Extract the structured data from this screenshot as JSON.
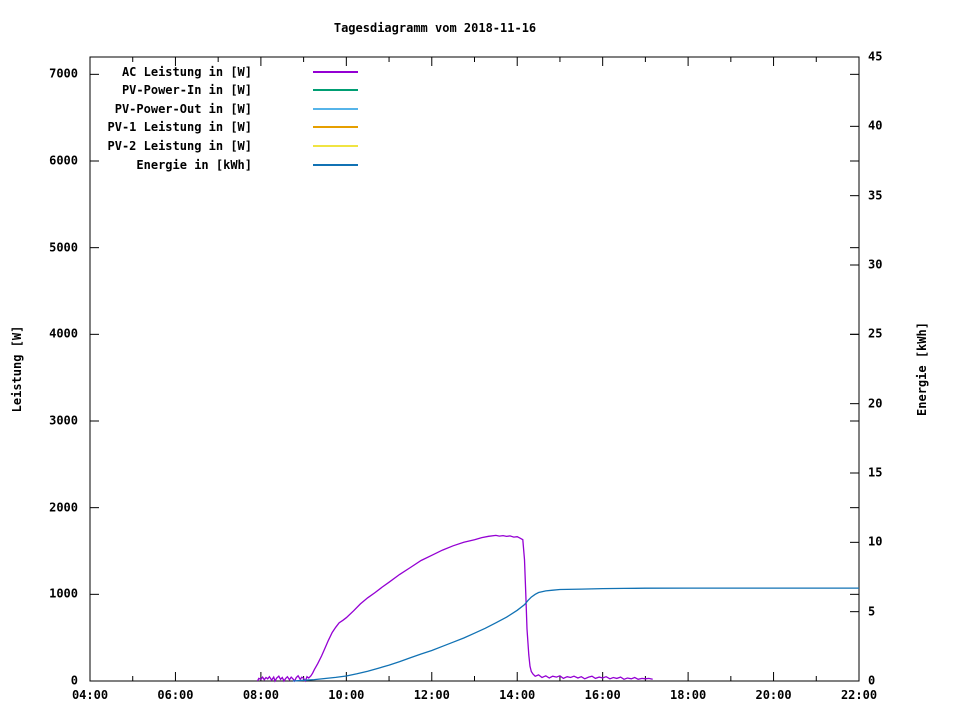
{
  "title": "Tagesdiagramm vom 2018-11-16",
  "chart_data": {
    "type": "line",
    "title": "Tagesdiagramm vom 2018-11-16",
    "grid": false,
    "legend_position": "top-left-inside",
    "x_axis": {
      "kind": "time",
      "range_hours": [
        4,
        22
      ],
      "major_step_hours": 2,
      "minor_step_hours": 1,
      "tick_labels": [
        "04:00",
        "06:00",
        "08:00",
        "10:00",
        "12:00",
        "14:00",
        "16:00",
        "18:00",
        "20:00",
        "22:00"
      ]
    },
    "y_axis": {
      "label": "Leistung [W]",
      "range": [
        0,
        7200
      ],
      "tick_values": [
        0,
        1000,
        2000,
        3000,
        4000,
        5000,
        6000,
        7000
      ],
      "tick_labels": [
        "0",
        "1000",
        "2000",
        "3000",
        "4000",
        "5000",
        "6000",
        "7000"
      ],
      "mirrored_on_right": true
    },
    "y2_axis": {
      "label": "Energie [kWh]",
      "range": [
        0,
        45
      ],
      "tick_values": [
        0,
        5,
        10,
        15,
        20,
        25,
        30,
        35,
        40,
        45
      ],
      "tick_labels": [
        "0",
        "5",
        "10",
        "15",
        "20",
        "25",
        "30",
        "35",
        "40",
        "45"
      ]
    },
    "series": [
      {
        "name": "AC Leistung in [W]",
        "color": "#9400D3",
        "axis": "y1",
        "points": [
          [
            7.92,
            0
          ],
          [
            7.95,
            30
          ],
          [
            8.0,
            20
          ],
          [
            8.04,
            45
          ],
          [
            8.08,
            15
          ],
          [
            8.12,
            40
          ],
          [
            8.16,
            25
          ],
          [
            8.2,
            50
          ],
          [
            8.25,
            10
          ],
          [
            8.3,
            45
          ],
          [
            8.33,
            0
          ],
          [
            8.37,
            35
          ],
          [
            8.42,
            55
          ],
          [
            8.46,
            20
          ],
          [
            8.5,
            40
          ],
          [
            8.54,
            0
          ],
          [
            8.58,
            30
          ],
          [
            8.62,
            50
          ],
          [
            8.67,
            15
          ],
          [
            8.71,
            45
          ],
          [
            8.75,
            25
          ],
          [
            8.79,
            0
          ],
          [
            8.83,
            40
          ],
          [
            8.87,
            60
          ],
          [
            8.92,
            20
          ],
          [
            8.96,
            45
          ],
          [
            9.0,
            30
          ],
          [
            9.04,
            0
          ],
          [
            9.08,
            50
          ],
          [
            9.12,
            35
          ],
          [
            9.17,
            60
          ],
          [
            9.21,
            90
          ],
          [
            9.25,
            130
          ],
          [
            9.33,
            200
          ],
          [
            9.42,
            290
          ],
          [
            9.5,
            380
          ],
          [
            9.58,
            470
          ],
          [
            9.67,
            560
          ],
          [
            9.75,
            620
          ],
          [
            9.83,
            670
          ],
          [
            9.92,
            700
          ],
          [
            10.0,
            730
          ],
          [
            10.17,
            810
          ],
          [
            10.33,
            890
          ],
          [
            10.5,
            960
          ],
          [
            10.67,
            1020
          ],
          [
            10.83,
            1080
          ],
          [
            11.0,
            1140
          ],
          [
            11.25,
            1230
          ],
          [
            11.5,
            1310
          ],
          [
            11.75,
            1390
          ],
          [
            12.0,
            1450
          ],
          [
            12.25,
            1510
          ],
          [
            12.5,
            1560
          ],
          [
            12.75,
            1600
          ],
          [
            13.0,
            1630
          ],
          [
            13.17,
            1655
          ],
          [
            13.33,
            1670
          ],
          [
            13.5,
            1680
          ],
          [
            13.58,
            1672
          ],
          [
            13.67,
            1678
          ],
          [
            13.75,
            1668
          ],
          [
            13.83,
            1674
          ],
          [
            13.92,
            1660
          ],
          [
            14.0,
            1665
          ],
          [
            14.08,
            1645
          ],
          [
            14.13,
            1630
          ],
          [
            14.17,
            1400
          ],
          [
            14.2,
            1000
          ],
          [
            14.23,
            600
          ],
          [
            14.27,
            300
          ],
          [
            14.3,
            170
          ],
          [
            14.33,
            110
          ],
          [
            14.37,
            80
          ],
          [
            14.42,
            55
          ],
          [
            14.5,
            70
          ],
          [
            14.58,
            40
          ],
          [
            14.67,
            60
          ],
          [
            14.75,
            35
          ],
          [
            14.83,
            55
          ],
          [
            14.92,
            45
          ],
          [
            15.0,
            60
          ],
          [
            15.08,
            30
          ],
          [
            15.17,
            50
          ],
          [
            15.25,
            40
          ],
          [
            15.33,
            55
          ],
          [
            15.42,
            35
          ],
          [
            15.5,
            50
          ],
          [
            15.58,
            25
          ],
          [
            15.67,
            45
          ],
          [
            15.75,
            55
          ],
          [
            15.83,
            30
          ],
          [
            15.92,
            45
          ],
          [
            16.0,
            35
          ],
          [
            16.08,
            50
          ],
          [
            16.17,
            25
          ],
          [
            16.25,
            40
          ],
          [
            16.33,
            30
          ],
          [
            16.42,
            45
          ],
          [
            16.5,
            20
          ],
          [
            16.58,
            35
          ],
          [
            16.67,
            25
          ],
          [
            16.75,
            40
          ],
          [
            16.83,
            20
          ],
          [
            16.92,
            30
          ],
          [
            17.0,
            25
          ],
          [
            17.08,
            30
          ],
          [
            17.17,
            20
          ]
        ]
      },
      {
        "name": "PV-Power-In in [W]",
        "color": "#009E73",
        "axis": "y1",
        "points": []
      },
      {
        "name": "PV-Power-Out in [W]",
        "color": "#56B4E9",
        "axis": "y1",
        "points": []
      },
      {
        "name": "PV-1 Leistung in [W]",
        "color": "#E69F00",
        "axis": "y1",
        "points": []
      },
      {
        "name": "PV-2 Leistung in [W]",
        "color": "#F0E442",
        "axis": "y1",
        "points": []
      },
      {
        "name": "Energie in [kWh]",
        "color": "#1172B4",
        "axis": "y2",
        "points": [
          [
            8.75,
            0
          ],
          [
            9.0,
            0.05
          ],
          [
            9.25,
            0.1
          ],
          [
            9.5,
            0.18
          ],
          [
            9.75,
            0.26
          ],
          [
            10.0,
            0.36
          ],
          [
            10.25,
            0.52
          ],
          [
            10.5,
            0.7
          ],
          [
            10.75,
            0.92
          ],
          [
            11.0,
            1.15
          ],
          [
            11.25,
            1.4
          ],
          [
            11.5,
            1.67
          ],
          [
            11.75,
            1.95
          ],
          [
            12.0,
            2.2
          ],
          [
            12.25,
            2.5
          ],
          [
            12.5,
            2.8
          ],
          [
            12.75,
            3.1
          ],
          [
            13.0,
            3.45
          ],
          [
            13.25,
            3.8
          ],
          [
            13.5,
            4.2
          ],
          [
            13.75,
            4.6
          ],
          [
            14.0,
            5.1
          ],
          [
            14.17,
            5.5
          ],
          [
            14.25,
            5.8
          ],
          [
            14.33,
            6.05
          ],
          [
            14.42,
            6.25
          ],
          [
            14.5,
            6.38
          ],
          [
            14.67,
            6.5
          ],
          [
            14.83,
            6.55
          ],
          [
            15.0,
            6.6
          ],
          [
            15.5,
            6.63
          ],
          [
            16.0,
            6.66
          ],
          [
            16.5,
            6.68
          ],
          [
            17.0,
            6.69
          ],
          [
            18.0,
            6.7
          ],
          [
            19.0,
            6.7
          ],
          [
            20.0,
            6.7
          ],
          [
            21.0,
            6.7
          ],
          [
            22.0,
            6.7
          ]
        ]
      }
    ]
  }
}
